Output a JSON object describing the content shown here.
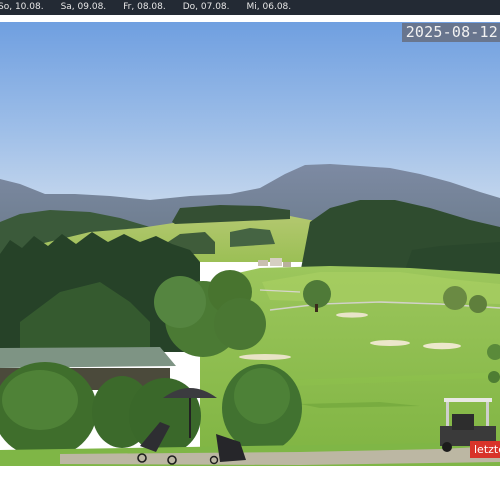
{
  "day_nav": {
    "items": [
      {
        "label": "So, 10.08."
      },
      {
        "label": "Sa, 09.08."
      },
      {
        "label": "Fr, 08.08."
      },
      {
        "label": "Do, 07.08."
      },
      {
        "label": "Mi, 06.08."
      }
    ]
  },
  "webcam": {
    "timestamp": "2025-08-12",
    "latest_label": "letzte"
  },
  "colors": {
    "nav_background": "#232a34",
    "latest_button": "#d8342a",
    "sky_top": "#6f9fe0",
    "sky_bottom": "#c6d9ee",
    "fairway": "#8fbe52"
  }
}
